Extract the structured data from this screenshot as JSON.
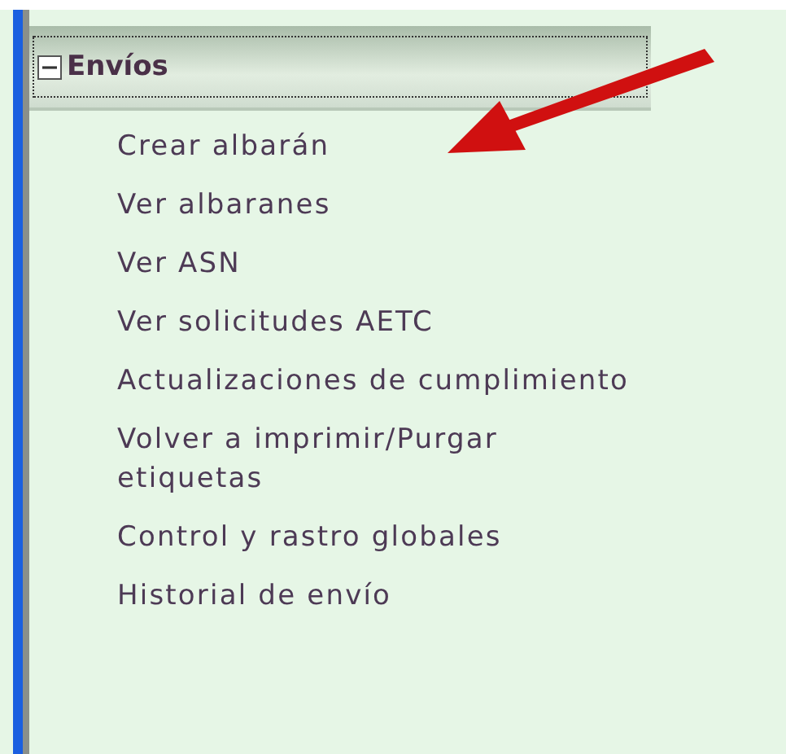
{
  "section": {
    "title": "Envíos",
    "expanded": true,
    "items": [
      {
        "label": "Crear albarán"
      },
      {
        "label": "Ver albaranes"
      },
      {
        "label": "Ver ASN"
      },
      {
        "label": "Ver solicitudes AETC"
      },
      {
        "label": "Actualizaciones de cumplimiento"
      },
      {
        "label": "Volver a imprimir/Purgar etiquetas"
      },
      {
        "label": "Control y rastro globales"
      },
      {
        "label": "Historial de envío"
      }
    ]
  }
}
